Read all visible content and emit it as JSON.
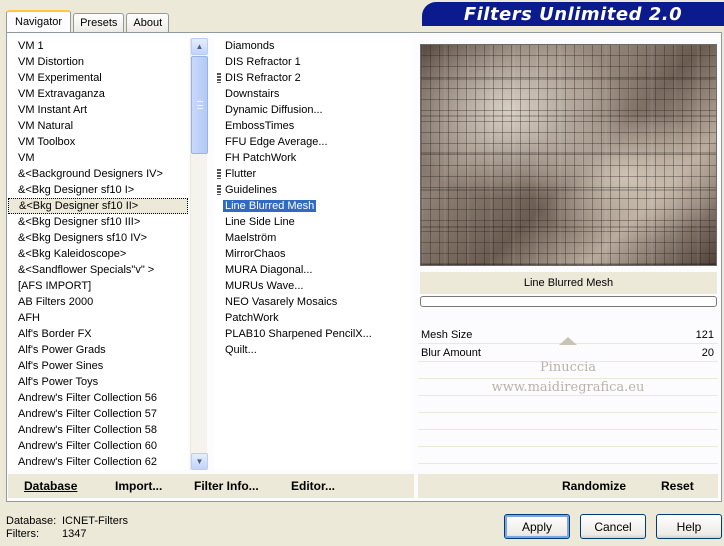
{
  "tabs": [
    "Navigator",
    "Presets",
    "About"
  ],
  "title": "Filters Unlimited 2.0",
  "categories": [
    "VM 1",
    "VM Distortion",
    "VM Experimental",
    "VM Extravaganza",
    "VM Instant Art",
    "VM Natural",
    "VM Toolbox",
    "VM",
    "&<Background Designers IV>",
    "&<Bkg Designer sf10 I>",
    "&<Bkg Designer sf10 II>",
    "&<Bkg Designer sf10 III>",
    "&<Bkg Designers sf10 IV>",
    "&<Bkg Kaleidoscope>",
    "&<Sandflower Specials\"v\" >",
    "[AFS IMPORT]",
    "AB Filters 2000",
    "AFH",
    "Alf's Border FX",
    "Alf's Power Grads",
    "Alf's Power Sines",
    "Alf's Power Toys",
    "Andrew's Filter Collection 56",
    "Andrew's Filter Collection 57",
    "Andrew's Filter Collection 58",
    "Andrew's Filter Collection 60",
    "Andrew's Filter Collection 62"
  ],
  "filters": [
    {
      "label": "Diamonds",
      "marker": false
    },
    {
      "label": "DIS Refractor 1",
      "marker": false
    },
    {
      "label": "DIS Refractor 2",
      "marker": true
    },
    {
      "label": "Downstairs",
      "marker": false
    },
    {
      "label": "Dynamic Diffusion...",
      "marker": false
    },
    {
      "label": "EmbossTimes",
      "marker": false
    },
    {
      "label": "FFU Edge Average...",
      "marker": false
    },
    {
      "label": "FH PatchWork",
      "marker": false
    },
    {
      "label": "Flutter",
      "marker": true
    },
    {
      "label": "Guidelines",
      "marker": true
    },
    {
      "label": "Line Blurred Mesh",
      "marker": false
    },
    {
      "label": "Line Side Line",
      "marker": false
    },
    {
      "label": "Maelström",
      "marker": false
    },
    {
      "label": "MirrorChaos",
      "marker": false
    },
    {
      "label": "MURA Diagonal...",
      "marker": false
    },
    {
      "label": "MURUs Wave...",
      "marker": false
    },
    {
      "label": "NEO Vasarely Mosaics",
      "marker": false
    },
    {
      "label": "PatchWork",
      "marker": false
    },
    {
      "label": "PLAB10 Sharpened PencilX...",
      "marker": false
    },
    {
      "label": "Quilt...",
      "marker": false
    }
  ],
  "selected_category": "&<Bkg Designer sf10 II>",
  "selected_filter": "Line Blurred Mesh",
  "preview_filter_name": "Line Blurred Mesh",
  "params": [
    {
      "label": "Mesh Size",
      "value": "121"
    },
    {
      "label": "Blur Amount",
      "value": "20"
    }
  ],
  "watermark": {
    "line1": "Pinuccia",
    "line2": "www.maidiregrafica.eu"
  },
  "toolbar_left": {
    "database": "Database",
    "import": "Import...",
    "filter_info": "Filter Info...",
    "editor": "Editor..."
  },
  "toolbar_right": {
    "randomize": "Randomize",
    "reset": "Reset"
  },
  "status": {
    "database_label": "Database:",
    "database_value": "ICNET-Filters",
    "filters_label": "Filters:",
    "filters_value": "1347"
  },
  "buttons": {
    "apply": "Apply",
    "cancel": "Cancel",
    "help": "Help"
  }
}
